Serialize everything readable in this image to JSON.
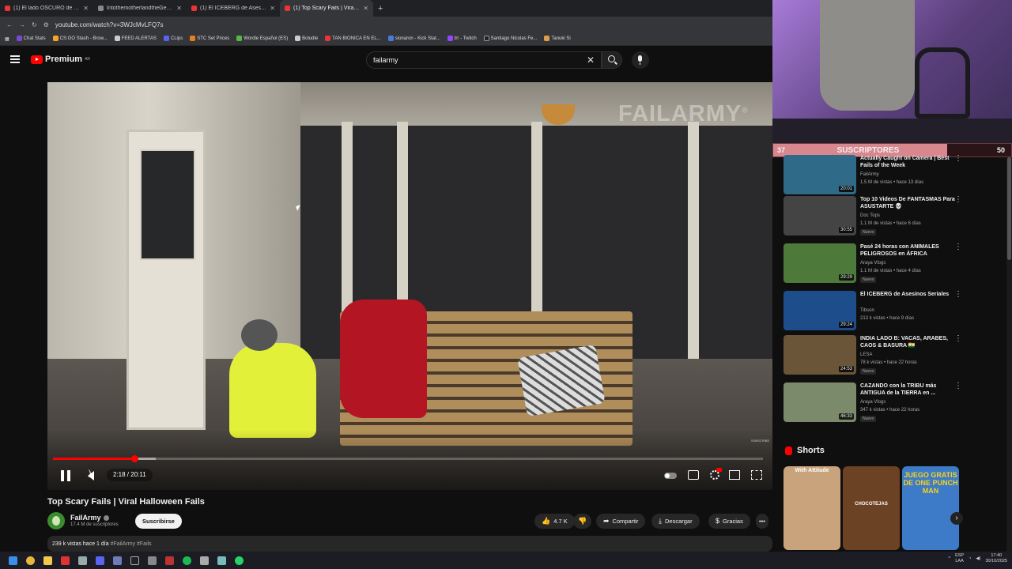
{
  "browser": {
    "tabs": [
      {
        "title": "(1) El lado OSCURO de ARGENT",
        "active": false
      },
      {
        "title": "IntothemotherlandtheGerman",
        "active": false
      },
      {
        "title": "(1) El ICEBERG de Asesinos Seri",
        "active": false
      },
      {
        "title": "(1) Top Scary Fails | Viral Ha",
        "active": true
      }
    ],
    "new_tab": "+",
    "url": "youtube.com/watch?v=3WJcMvLFQ7s",
    "bookmarks": [
      "Chat Stats",
      "CS:GO Stash - Brow...",
      "FEED ALERTAS",
      "CLips",
      "STC Set Prices",
      "Wordle Español (ES)",
      "Boludle",
      "TAN BIONICA EN EL...",
      "sionaron - Kick Stat...",
      "trr - Twitch",
      "Santiago Nicolas Fe...",
      "Tanuki Si"
    ]
  },
  "header": {
    "logo_text": "Premium",
    "country": "AR",
    "search_value": "failarmy",
    "clear": "✕"
  },
  "player": {
    "watermark": "FAILARMY",
    "watermark_mark": "®",
    "subscribe_watermark": "SUBSCRIBE",
    "time": "2:18 / 20:11",
    "progress": 0.115,
    "buffered": 0.145
  },
  "video": {
    "title": "Top Scary Fails | Viral Halloween Fails",
    "channel": "FailArmy",
    "subscribers": "17.4 M de suscriptores",
    "subscribe_label": "Suscribirse",
    "likes": "4.7 K",
    "share_label": "Compartir",
    "download_label": "Descargar",
    "thanks_label": "Gracias",
    "more": "•••",
    "views_date": "239 k vistas  hace 1 día",
    "hashtags": "#FailArmy #Fails"
  },
  "recommendations": [
    {
      "title": "Actually Caught on Camera | Best Fails of the Week",
      "channel": "FailArmy",
      "meta": "1.5 M de vistas • hace 13 días",
      "duration": "20:01",
      "badge": "",
      "thumb": "#2f6a88"
    },
    {
      "title": "Top 10 Videos De FANTASMAS Para ASUSTARTE 💀",
      "channel": "Doc Tops",
      "meta": "1.1 M de vistas • hace 6 días",
      "duration": "30:55",
      "badge": "Nuevo",
      "thumb": "#444444"
    },
    {
      "title": "Pasé 24 horas con ANIMALES PELIGROSOS en ÁFRICA",
      "channel": "Araya Vlogs",
      "meta": "1.1 M de vistas • hace 4 días",
      "duration": "29:29",
      "badge": "Nuevo",
      "thumb": "#4d7a3a"
    },
    {
      "title": "El ICEBERG de Asesinos Seriales",
      "channel": "Tibson",
      "meta": "213 k vistas • hace 9 días",
      "duration": "29:24",
      "badge": "",
      "thumb": "#1d4d8a"
    },
    {
      "title": "INDIA LADO B: VACAS, ARABES, CAOS & BASURA 🇮🇳",
      "channel": "LESA",
      "meta": "78 k vistas • hace 22 horas",
      "duration": "24:53",
      "badge": "Nuevo",
      "thumb": "#6b5538"
    },
    {
      "title": "CAZANDO con la TRIBU más ANTIGUA de la TIERRA en ...",
      "channel": "Araya Vlogs",
      "meta": "347 k vistas • hace 22 horas",
      "duration": "46:33",
      "badge": "Nuevo",
      "thumb": "#7b8a6a"
    }
  ],
  "shorts": {
    "heading": "Shorts",
    "items": [
      {
        "label": "With Attitude",
        "bg": "#c9a37c",
        "color": "#ffffff"
      },
      {
        "label": "CHOCOTEJAS",
        "bg": "#6b4224",
        "color": "#ffffff"
      },
      {
        "label": "JUEGO GRATIS DE ONE PUNCH MAN",
        "bg": "#3d7bc8",
        "color": "#f6d31a"
      }
    ]
  },
  "stream": {
    "subs_current": "37",
    "subs_label": "SUSCRIPTORES",
    "subs_goal": "50",
    "subs_progress": 0.74
  },
  "taskbar": {
    "lang": "ESP\nLAA",
    "time": "17:40",
    "date": "30/10/2025"
  },
  "colors": {
    "brand_red": "#ff0000",
    "background": "#0f0f0f"
  },
  "icons": [
    "menu-icon",
    "youtube-logo-icon",
    "search-icon",
    "mic-icon",
    "pause-icon",
    "volume-icon",
    "settings-icon",
    "fullscreen-icon",
    "like-icon",
    "dislike-icon",
    "share-icon",
    "download-icon",
    "thanks-icon",
    "more-icon",
    "shorts-icon",
    "verified-icon"
  ]
}
